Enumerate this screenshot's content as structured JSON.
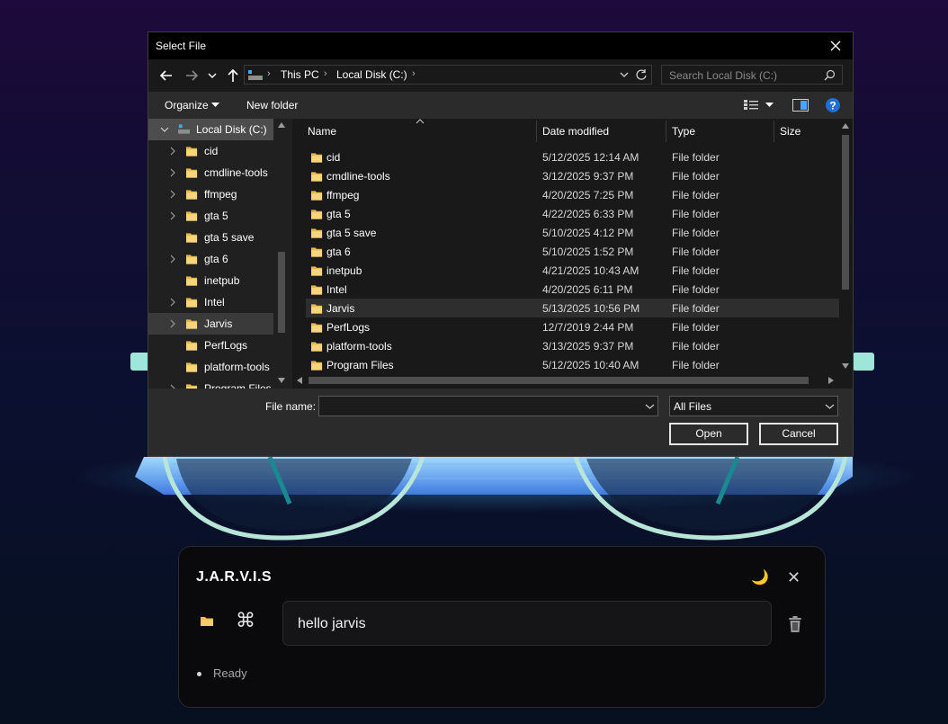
{
  "dialog": {
    "title": "Select File",
    "breadcrumbs": [
      "This PC",
      "Local Disk (C:)"
    ],
    "search_placeholder": "Search Local Disk (C:)",
    "organize_label": "Organize",
    "new_folder_label": "New folder",
    "nav_items": [
      {
        "label": "Local Disk (C:)",
        "expandable": true,
        "expanded": true,
        "selected": true
      },
      {
        "label": "cid",
        "expandable": true
      },
      {
        "label": "cmdline-tools",
        "expandable": true
      },
      {
        "label": "ffmpeg",
        "expandable": true
      },
      {
        "label": "gta 5",
        "expandable": true
      },
      {
        "label": "gta 5 save",
        "expandable": false
      },
      {
        "label": "gta 6",
        "expandable": true
      },
      {
        "label": "inetpub",
        "expandable": false
      },
      {
        "label": "Intel",
        "expandable": true
      },
      {
        "label": "Jarvis",
        "expandable": true,
        "hover": true
      },
      {
        "label": "PerfLogs",
        "expandable": false
      },
      {
        "label": "platform-tools",
        "expandable": false
      },
      {
        "label": "Program Files",
        "expandable": true
      }
    ],
    "columns": {
      "name": "Name",
      "date": "Date modified",
      "type": "Type",
      "size": "Size"
    },
    "files": [
      {
        "name": "cid",
        "date": "5/12/2025 12:14 AM",
        "type": "File folder"
      },
      {
        "name": "cmdline-tools",
        "date": "3/12/2025 9:37 PM",
        "type": "File folder"
      },
      {
        "name": "ffmpeg",
        "date": "4/20/2025 7:25 PM",
        "type": "File folder"
      },
      {
        "name": "gta 5",
        "date": "4/22/2025 6:33 PM",
        "type": "File folder"
      },
      {
        "name": "gta 5 save",
        "date": "5/10/2025 4:12 PM",
        "type": "File folder"
      },
      {
        "name": "gta 6",
        "date": "5/10/2025 1:52 PM",
        "type": "File folder"
      },
      {
        "name": "inetpub",
        "date": "4/21/2025 10:43 AM",
        "type": "File folder"
      },
      {
        "name": "Intel",
        "date": "4/20/2025 6:11 PM",
        "type": "File folder"
      },
      {
        "name": "Jarvis",
        "date": "5/13/2025 10:56 PM",
        "type": "File folder",
        "hover": true
      },
      {
        "name": "PerfLogs",
        "date": "12/7/2019 2:44 PM",
        "type": "File folder"
      },
      {
        "name": "platform-tools",
        "date": "3/13/2025 9:37 PM",
        "type": "File folder"
      },
      {
        "name": "Program Files",
        "date": "5/12/2025 10:40 AM",
        "type": "File folder"
      }
    ],
    "file_name_label": "File name:",
    "file_name_value": "",
    "filter_value": "All Files",
    "open_label": "Open",
    "cancel_label": "Cancel"
  },
  "jarvis": {
    "title": "J.A.R.V.I.S",
    "input_value": "hello jarvis",
    "status": "Ready",
    "icons": [
      "moon-icon",
      "close-icon",
      "folder-icon",
      "command-icon",
      "trash-icon"
    ]
  },
  "colors": {
    "dialog_bg": "#202020",
    "titlebar_bg": "#000000",
    "folder_yellow": "#f3d27a",
    "panel_bg": "#0a0a0c",
    "accent_cyan": "#3fd1c6"
  }
}
